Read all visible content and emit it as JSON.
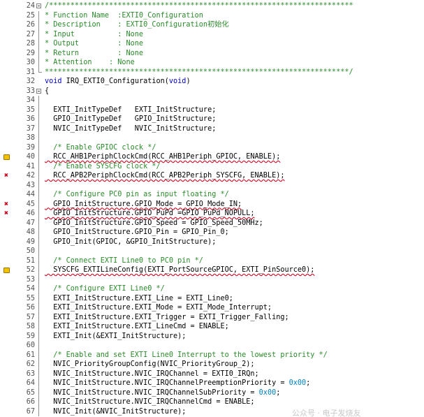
{
  "editor": {
    "lines": [
      {
        "n": "24",
        "text": "/***********************************************************************",
        "type": "comment",
        "fold": "start"
      },
      {
        "n": "25",
        "text": "* Function Name  :EXTI0_Configuration",
        "type": "comment",
        "fold": "line"
      },
      {
        "n": "26",
        "text": "* Description    : EXTI0_Configuration初始化",
        "type": "comment",
        "fold": "line"
      },
      {
        "n": "27",
        "text": "* Input          : None",
        "type": "comment",
        "fold": "line"
      },
      {
        "n": "28",
        "text": "* Output         : None",
        "type": "comment",
        "fold": "line"
      },
      {
        "n": "29",
        "text": "* Return         : None",
        "type": "comment",
        "fold": "line"
      },
      {
        "n": "30",
        "text": "* Attention    : None",
        "type": "comment",
        "fold": "line"
      },
      {
        "n": "31",
        "text": "***********************************************************************/",
        "type": "comment",
        "fold": "end"
      },
      {
        "n": "32",
        "text": "void IRQ_EXTI0_Configuration(void)",
        "type": "code",
        "fold": ""
      },
      {
        "n": "33",
        "text": "{",
        "type": "code",
        "fold": "start"
      },
      {
        "n": "34",
        "text": "",
        "type": "code",
        "fold": "line"
      },
      {
        "n": "35",
        "text": "  EXTI_InitTypeDef   EXTI_InitStructure;",
        "type": "code",
        "fold": "line"
      },
      {
        "n": "36",
        "text": "  GPIO_InitTypeDef   GPIO_InitStructure;",
        "type": "code",
        "fold": "line"
      },
      {
        "n": "37",
        "text": "  NVIC_InitTypeDef   NVIC_InitStructure;",
        "type": "code",
        "fold": "line"
      },
      {
        "n": "38",
        "text": "",
        "type": "code",
        "fold": "line"
      },
      {
        "n": "39",
        "text": "  /* Enable GPIOC clock */",
        "type": "comment",
        "fold": "line"
      },
      {
        "n": "40",
        "text": "  RCC_AHB1PeriphClockCmd(RCC_AHB1Periph_GPIOC, ENABLE);",
        "type": "code",
        "fold": "line",
        "marker": "warning",
        "squiggle": true
      },
      {
        "n": "41",
        "text": "  /* Enable SYSCFG clock */",
        "type": "comment",
        "fold": "line"
      },
      {
        "n": "42",
        "text": "  RCC_APB2PeriphClockCmd(RCC_APB2Periph_SYSCFG, ENABLE);",
        "type": "code",
        "fold": "line",
        "marker": "error",
        "squiggle": true
      },
      {
        "n": "43",
        "text": "",
        "type": "code",
        "fold": "line"
      },
      {
        "n": "44",
        "text": "  /* Configure PC0 pin as input floating */",
        "type": "comment",
        "fold": "line"
      },
      {
        "n": "45",
        "text": "  GPIO_InitStructure.GPIO_Mode = GPIO_Mode_IN;",
        "type": "code",
        "fold": "line",
        "marker": "error",
        "squiggle": true
      },
      {
        "n": "46",
        "text": "  GPIO_InitStructure.GPIO_PuPd =GPIO_PuPd_NOPULL;",
        "type": "code",
        "fold": "line",
        "marker": "error",
        "squiggle": true
      },
      {
        "n": "47",
        "text": "  GPIO_InitStructure.GPIO_Speed = GPIO_Speed_50MHz;",
        "type": "code",
        "fold": "line"
      },
      {
        "n": "48",
        "text": "  GPIO_InitStructure.GPIO_Pin = GPIO_Pin_0;",
        "type": "code",
        "fold": "line"
      },
      {
        "n": "49",
        "text": "  GPIO_Init(GPIOC, &GPIO_InitStructure);",
        "type": "code",
        "fold": "line"
      },
      {
        "n": "50",
        "text": "",
        "type": "code",
        "fold": "line"
      },
      {
        "n": "51",
        "text": "  /* Connect EXTI Line0 to PC0 pin */",
        "type": "comment",
        "fold": "line"
      },
      {
        "n": "52",
        "text": "  SYSCFG_EXTILineConfig(EXTI_PortSourceGPIOC, EXTI_PinSource0);",
        "type": "code",
        "fold": "line",
        "marker": "warning",
        "squiggle": true
      },
      {
        "n": "53",
        "text": "",
        "type": "code",
        "fold": "line"
      },
      {
        "n": "54",
        "text": "  /* Configure EXTI Line0 */",
        "type": "comment",
        "fold": "line"
      },
      {
        "n": "55",
        "text": "  EXTI_InitStructure.EXTI_Line = EXTI_Line0;",
        "type": "code",
        "fold": "line"
      },
      {
        "n": "56",
        "text": "  EXTI_InitStructure.EXTI_Mode = EXTI_Mode_Interrupt;",
        "type": "code",
        "fold": "line"
      },
      {
        "n": "57",
        "text": "  EXTI_InitStructure.EXTI_Trigger = EXTI_Trigger_Falling;",
        "type": "code",
        "fold": "line"
      },
      {
        "n": "58",
        "text": "  EXTI_InitStructure.EXTI_LineCmd = ENABLE;",
        "type": "code",
        "fold": "line"
      },
      {
        "n": "59",
        "text": "  EXTI_Init(&EXTI_InitStructure);",
        "type": "code",
        "fold": "line"
      },
      {
        "n": "60",
        "text": "",
        "type": "code",
        "fold": "line"
      },
      {
        "n": "61",
        "text": "  /* Enable and set EXTI Line0 Interrupt to the lowest priority */",
        "type": "comment",
        "fold": "line"
      },
      {
        "n": "62",
        "text": "  NVIC_PriorityGroupConfig(NVIC_PriorityGroup_2);",
        "type": "code",
        "fold": "line"
      },
      {
        "n": "63",
        "text": "  NVIC_InitStructure.NVIC_IRQChannel = EXTI0_IRQn;",
        "type": "code",
        "fold": "line"
      },
      {
        "n": "64",
        "text": "  NVIC_InitStructure.NVIC_IRQChannelPreemptionPriority = 0x00;",
        "type": "code",
        "fold": "line"
      },
      {
        "n": "65",
        "text": "  NVIC_InitStructure.NVIC_IRQChannelSubPriority = 0x00;",
        "type": "code",
        "fold": "line"
      },
      {
        "n": "66",
        "text": "  NVIC_InitStructure.NVIC_IRQChannelCmd = ENABLE;",
        "type": "code",
        "fold": "line"
      },
      {
        "n": "67",
        "text": "  NVIC_Init(&NVIC_InitStructure);",
        "type": "code",
        "fold": "line"
      }
    ]
  },
  "watermark": "公众号 · 电子发烧友"
}
